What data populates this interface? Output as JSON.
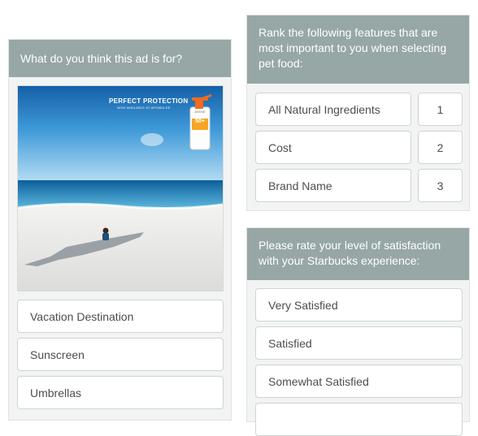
{
  "q1": {
    "title": "What do you think this ad is for?",
    "ad": {
      "headline": "PERFECT PROTECTION",
      "subline": "NOW AVAILABLE AT APOMIA.DE",
      "bottle_brand": "AVENE",
      "bottle_spf": "50+"
    },
    "options": [
      "Vacation Destination",
      "Sunscreen",
      "Umbrellas"
    ]
  },
  "q2": {
    "title": "Rank the following features that are most important to you when selecting pet food:",
    "items": [
      {
        "label": "All Natural Ingredients",
        "rank": "1"
      },
      {
        "label": "Cost",
        "rank": "2"
      },
      {
        "label": "Brand Name",
        "rank": "3"
      }
    ]
  },
  "q3": {
    "title": "Please rate your level of satisfaction with your Starbucks experience:",
    "options": [
      "Very Satisfied",
      "Satisfied",
      "Somewhat Satisfied"
    ]
  },
  "colors": {
    "header_bg": "#96a7a6",
    "card_bg": "#f2f3f3",
    "option_border": "#cfd4d4",
    "option_text": "#4d4d4d"
  }
}
